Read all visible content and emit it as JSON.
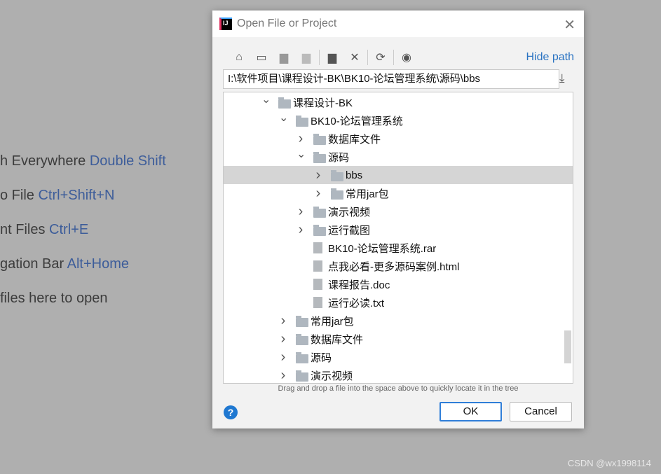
{
  "background_hints": [
    {
      "text": "h Everywhere ",
      "key": "Double Shift"
    },
    {
      "text": "o File ",
      "key": "Ctrl+Shift+N"
    },
    {
      "text": "nt Files ",
      "key": "Ctrl+E"
    },
    {
      "text": "gation Bar ",
      "key": "Alt+Home"
    },
    {
      "text": " files here to open",
      "key": ""
    }
  ],
  "watermark": "CSDN @wx1998114",
  "dialog": {
    "title": "Open File or Project",
    "toolbar": {
      "icons": [
        "home-icon",
        "desktop-icon",
        "project-folder-icon",
        "module-folder-icon",
        "new-folder-icon",
        "delete-icon",
        "refresh-icon",
        "show-hidden-icon"
      ],
      "hide_path": "Hide path"
    },
    "path": "I:\\软件项目\\课程设计-BK\\BK10-论坛管理系统\\源码\\bbs",
    "tree": [
      {
        "label": "课程设计-BK",
        "level": 0,
        "type": "folder",
        "expanded": true
      },
      {
        "label": "BK10-论坛管理系统",
        "level": 1,
        "type": "folder",
        "expanded": true
      },
      {
        "label": "数据库文件",
        "level": 2,
        "type": "folder",
        "expanded": false
      },
      {
        "label": "源码",
        "level": 2,
        "type": "folder",
        "expanded": true
      },
      {
        "label": "bbs",
        "level": 3,
        "type": "folder",
        "expanded": false,
        "selected": true
      },
      {
        "label": "常用jar包",
        "level": 3,
        "type": "folder",
        "expanded": false
      },
      {
        "label": "演示视频",
        "level": 2,
        "type": "folder",
        "expanded": false
      },
      {
        "label": "运行截图",
        "level": 2,
        "type": "folder",
        "expanded": false
      },
      {
        "label": "BK10-论坛管理系统.rar",
        "level": 2,
        "type": "file"
      },
      {
        "label": "点我必看-更多源码案例.html",
        "level": 2,
        "type": "file"
      },
      {
        "label": "课程报告.doc",
        "level": 2,
        "type": "file"
      },
      {
        "label": "运行必读.txt",
        "level": 2,
        "type": "file"
      },
      {
        "label": "常用jar包",
        "level": 1,
        "type": "folder",
        "expanded": false
      },
      {
        "label": "数据库文件",
        "level": 1,
        "type": "folder",
        "expanded": false
      },
      {
        "label": "源码",
        "level": 1,
        "type": "folder",
        "expanded": false
      },
      {
        "label": "演示视频",
        "level": 1,
        "type": "folder",
        "expanded": false
      }
    ],
    "drag_hint": "Drag and drop a file into the space above to quickly locate it in the tree",
    "ok": "OK",
    "cancel": "Cancel"
  }
}
